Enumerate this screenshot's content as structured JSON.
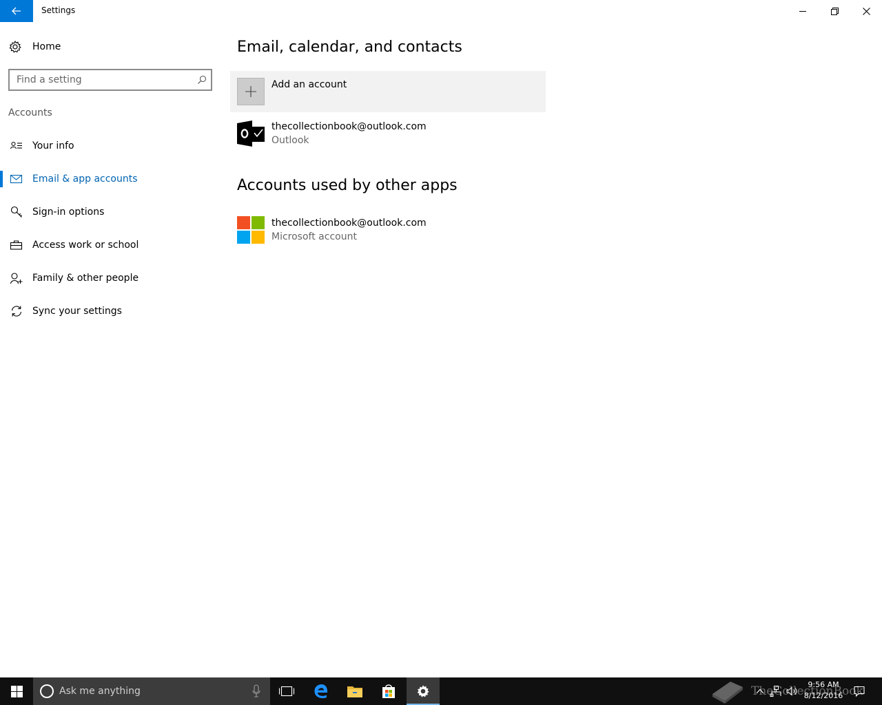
{
  "window": {
    "title": "Settings",
    "controls": {
      "minimize": "minimize",
      "restore": "restore",
      "close": "close"
    }
  },
  "sidebar": {
    "home_label": "Home",
    "search_placeholder": "Find a setting",
    "section_label": "Accounts",
    "items": [
      {
        "label": "Your info",
        "icon": "your-info-icon",
        "active": false
      },
      {
        "label": "Email & app accounts",
        "icon": "mail-icon",
        "active": true
      },
      {
        "label": "Sign-in options",
        "icon": "key-icon",
        "active": false
      },
      {
        "label": "Access work or school",
        "icon": "briefcase-icon",
        "active": false
      },
      {
        "label": "Family & other people",
        "icon": "add-person-icon",
        "active": false
      },
      {
        "label": "Sync your settings",
        "icon": "sync-icon",
        "active": false
      }
    ]
  },
  "main": {
    "email_section_title": "Email, calendar, and contacts",
    "add_account_label": "Add an account",
    "email_accounts": [
      {
        "email": "thecollectionbook@outlook.com",
        "provider": "Outlook",
        "icon": "outlook-icon"
      }
    ],
    "other_apps_section_title": "Accounts used by other apps",
    "other_accounts": [
      {
        "email": "thecollectionbook@outlook.com",
        "type": "Microsoft account",
        "icon": "microsoft-logo-icon"
      }
    ]
  },
  "taskbar": {
    "search_placeholder": "Ask me anything",
    "time": "9:56 AM",
    "date": "8/12/2016",
    "watermark": "TheCollectionBook",
    "accent": "#0078d7"
  }
}
